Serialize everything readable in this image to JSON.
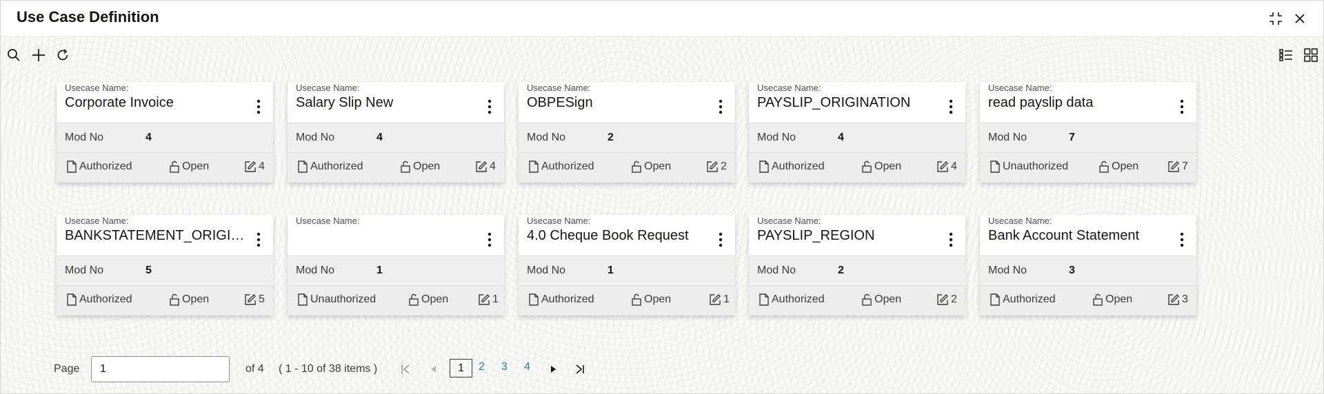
{
  "window": {
    "title": "Use Case Definition"
  },
  "toolbar": {
    "search": "search-icon",
    "add": "plus-icon",
    "refresh": "refresh-icon",
    "list_view": "list-view-icon",
    "tile_view": "tile-view-icon"
  },
  "card_labels": {
    "usecase_name": "Usecase Name:",
    "mod_no": "Mod No"
  },
  "cards": [
    {
      "name": "Corporate Invoice",
      "mod_no": "4",
      "status": "Authorized",
      "lock": "Open",
      "edits": "4"
    },
    {
      "name": "Salary Slip New",
      "mod_no": "4",
      "status": "Authorized",
      "lock": "Open",
      "edits": "4"
    },
    {
      "name": "OBPESign",
      "mod_no": "2",
      "status": "Authorized",
      "lock": "Open",
      "edits": "2"
    },
    {
      "name": "PAYSLIP_ORIGINATION",
      "mod_no": "4",
      "status": "Authorized",
      "lock": "Open",
      "edits": "4"
    },
    {
      "name": "read payslip data",
      "mod_no": "7",
      "status": "Unauthorized",
      "lock": "Open",
      "edits": "7"
    },
    {
      "name": "BANKSTATEMENT_ORIGINATION",
      "mod_no": "5",
      "status": "Authorized",
      "lock": "Open",
      "edits": "5"
    },
    {
      "name": "",
      "mod_no": "1",
      "status": "Unauthorized",
      "lock": "Open",
      "edits": "1"
    },
    {
      "name": "4.0 Cheque Book Request",
      "mod_no": "1",
      "status": "Authorized",
      "lock": "Open",
      "edits": "1"
    },
    {
      "name": "PAYSLIP_REGION",
      "mod_no": "2",
      "status": "Authorized",
      "lock": "Open",
      "edits": "2"
    },
    {
      "name": "Bank Account Statement",
      "mod_no": "3",
      "status": "Authorized",
      "lock": "Open",
      "edits": "3"
    }
  ],
  "pagination": {
    "page_label": "Page",
    "page_value": "1",
    "of_pages": "of 4",
    "items_info": "( 1 - 10 of 38 items )",
    "current_page": "1",
    "pages": [
      "2",
      "3",
      "4"
    ]
  },
  "colors": {
    "link": "#227e9e",
    "title": "#161513",
    "card_band": "#efefef"
  }
}
